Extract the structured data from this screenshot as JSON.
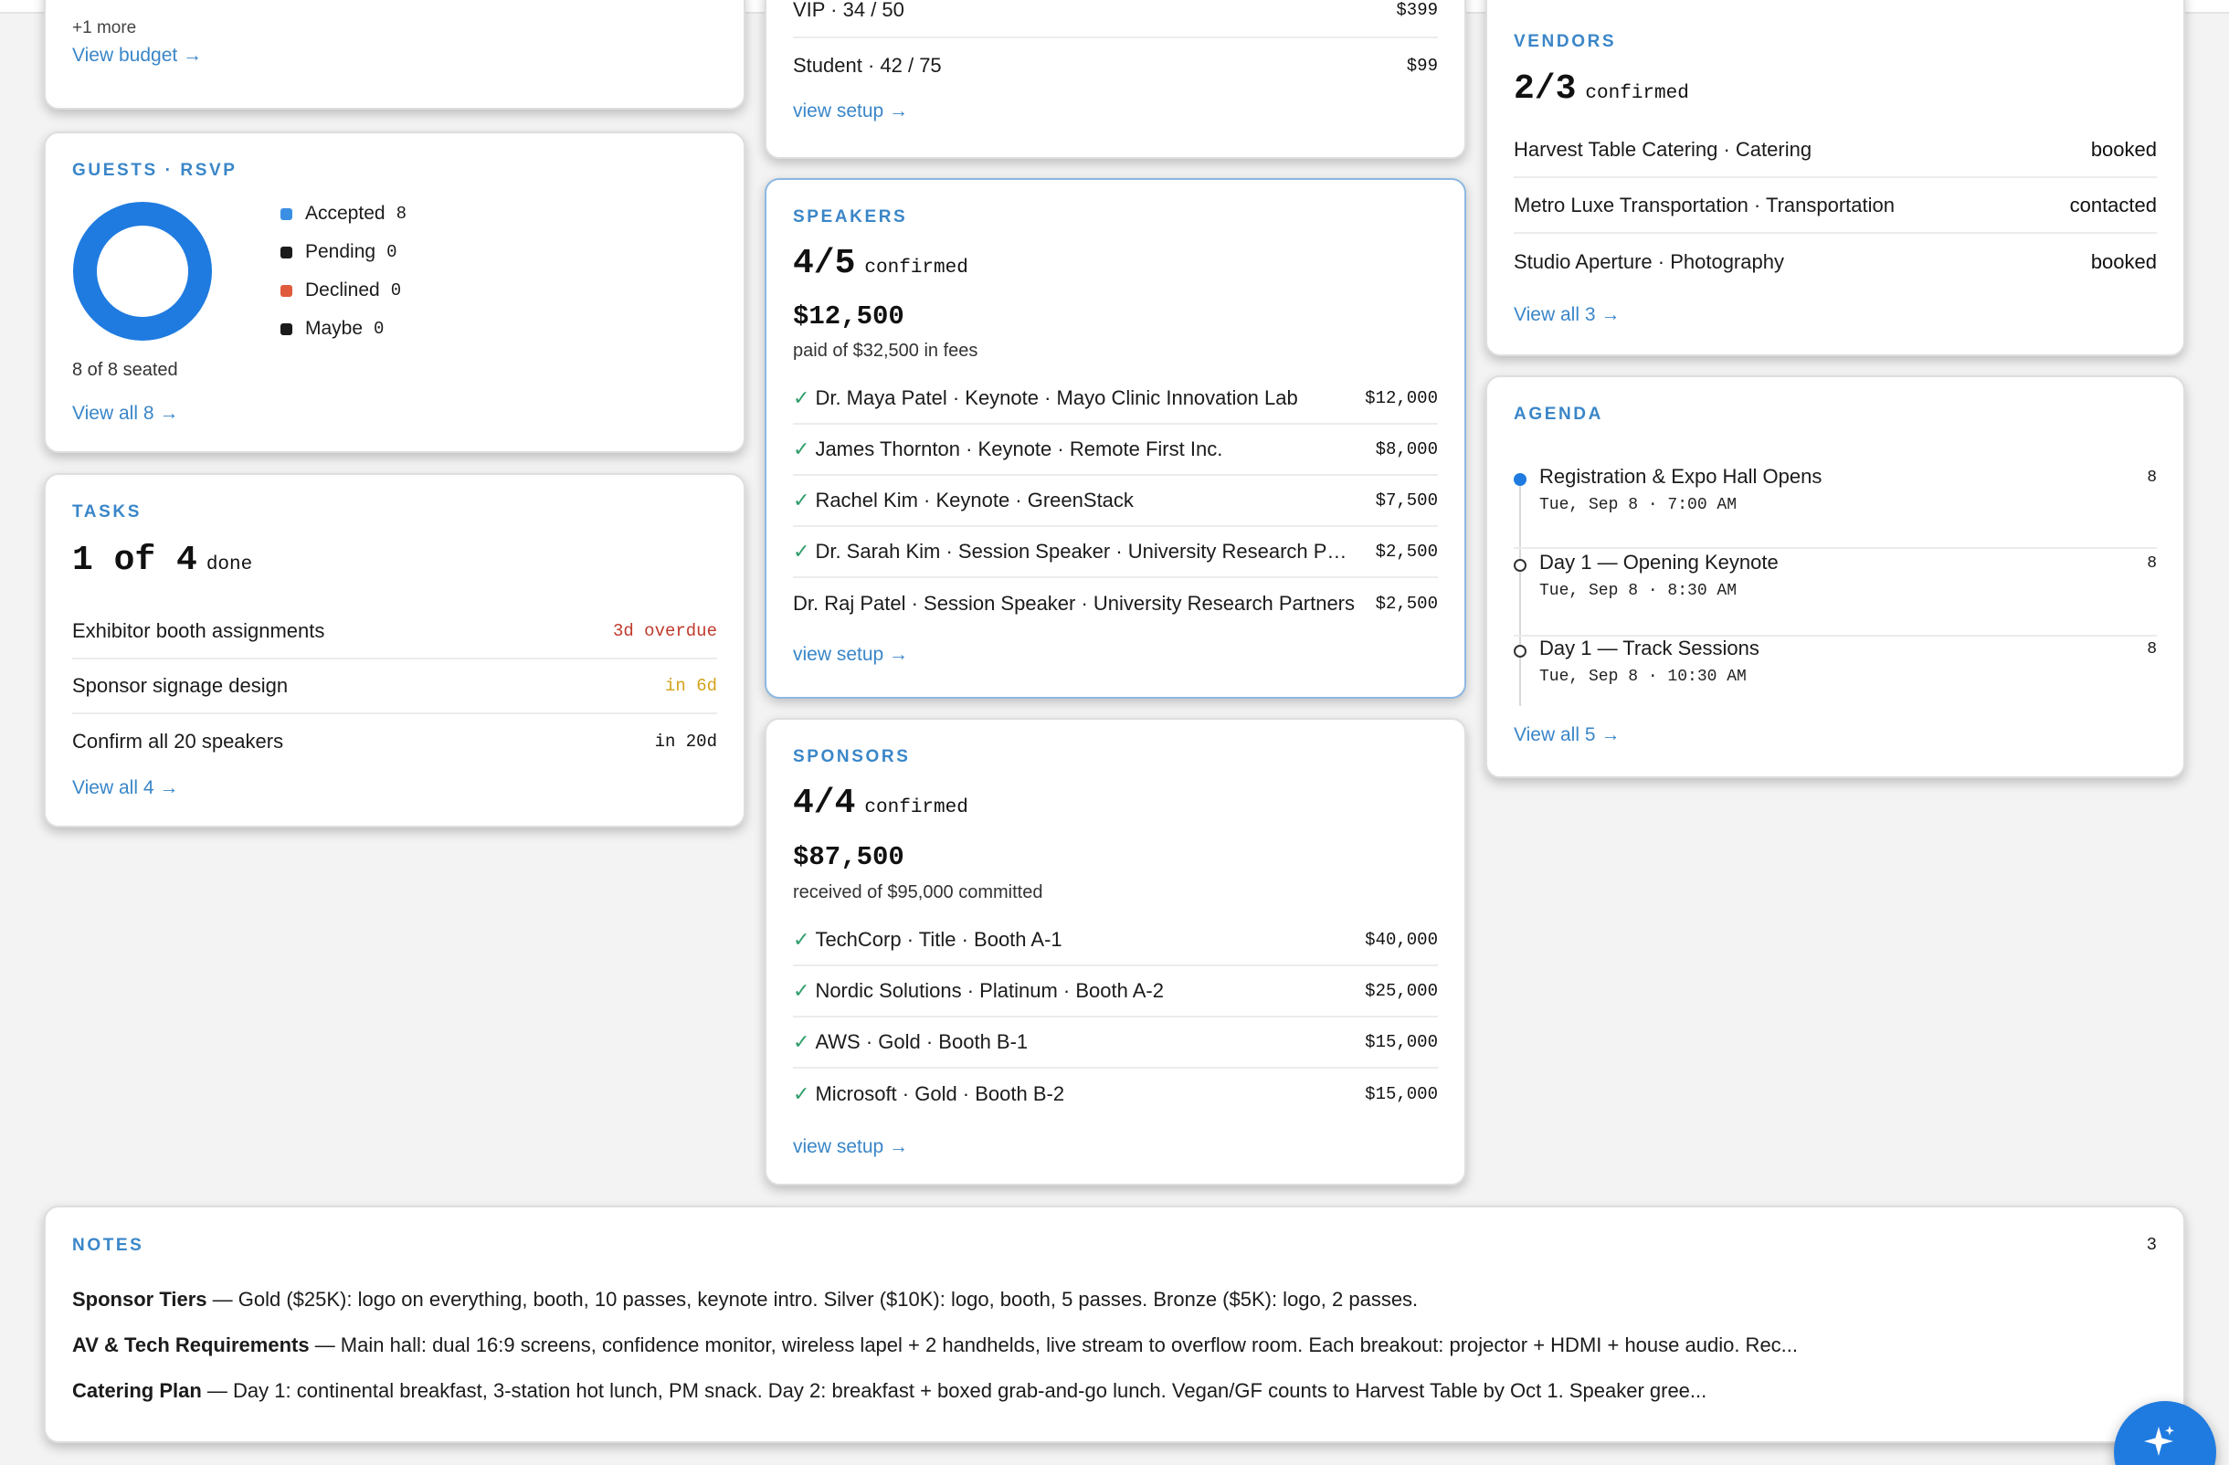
{
  "budget": {
    "more": "+1 more",
    "link": "View budget →"
  },
  "guests": {
    "title": "GUESTS · RSVP",
    "legend": [
      {
        "label": "Accepted",
        "count": "8",
        "color": "#3b8fe3"
      },
      {
        "label": "Pending",
        "count": "0",
        "color": "#1b1b1b"
      },
      {
        "label": "Declined",
        "count": "0",
        "color": "#e05a3c"
      },
      {
        "label": "Maybe",
        "count": "0",
        "color": "#1b1b1b"
      }
    ],
    "donut_color": "#1f7be0",
    "seated": "8 of 8 seated",
    "link": "View all 8 →"
  },
  "tasks": {
    "title": "TASKS",
    "big": "1 of 4",
    "suffix": "done",
    "items": [
      {
        "label": "Exhibitor booth assignments",
        "due": "3d overdue"
      },
      {
        "label": "Sponsor signage design",
        "due": "in 6d"
      },
      {
        "label": "Confirm all 20 speakers",
        "due": "in 20d"
      }
    ],
    "link": "View all 4 →"
  },
  "tickets": {
    "partial_label": "VIP · 34 / 50",
    "partial_value": "$399",
    "row_label": "Student · 42 / 75",
    "row_value": "$99",
    "link": "view setup →"
  },
  "speakers": {
    "title": "SPEAKERS",
    "big": "4/5",
    "suffix": "confirmed",
    "amount": "$12,500",
    "amount_sub": "paid of $32,500 in fees",
    "items": [
      {
        "check": "✓",
        "label": "Dr. Maya Patel · Keynote · Mayo Clinic Innovation Lab",
        "fee": "$12,000"
      },
      {
        "check": "✓",
        "label": "James Thornton · Keynote · Remote First Inc.",
        "fee": "$8,000"
      },
      {
        "check": "✓",
        "label": "Rachel Kim · Keynote · GreenStack",
        "fee": "$7,500"
      },
      {
        "check": "✓",
        "label": "Dr. Sarah Kim · Session Speaker · University Research Par...",
        "fee": "$2,500"
      },
      {
        "check": "",
        "label": "Dr. Raj Patel · Session Speaker · University Research Partners",
        "fee": "$2,500"
      }
    ],
    "link": "view setup →"
  },
  "sponsors": {
    "title": "SPONSORS",
    "big": "4/4",
    "suffix": "confirmed",
    "amount": "$87,500",
    "amount_sub": "received of $95,000 committed",
    "items": [
      {
        "check": "✓",
        "label": "TechCorp · Title · Booth A-1",
        "amount": "$40,000"
      },
      {
        "check": "✓",
        "label": "Nordic Solutions · Platinum · Booth A-2",
        "amount": "$25,000"
      },
      {
        "check": "✓",
        "label": "AWS · Gold · Booth B-1",
        "amount": "$15,000"
      },
      {
        "check": "✓",
        "label": "Microsoft · Gold · Booth B-2",
        "amount": "$15,000"
      }
    ],
    "link": "view setup →"
  },
  "vendors": {
    "title": "VENDORS",
    "big": "2/3",
    "suffix": "confirmed",
    "items": [
      {
        "label": "Harvest Table Catering · Catering",
        "status": "booked"
      },
      {
        "label": "Metro Luxe Transportation · Transportation",
        "status": "contacted"
      },
      {
        "label": "Studio Aperture · Photography",
        "status": "booked"
      }
    ],
    "link": "View all 3 →"
  },
  "agenda": {
    "title": "AGENDA",
    "items": [
      {
        "name": "Registration & Expo Hall Opens",
        "when": "Tue, Sep 8 · 7:00 AM",
        "count": "8"
      },
      {
        "name": "Day 1 — Opening Keynote",
        "when": "Tue, Sep 8 · 8:30 AM",
        "count": "8"
      },
      {
        "name": "Day 1 — Track Sessions",
        "when": "Tue, Sep 8 · 10:30 AM",
        "count": "8"
      }
    ],
    "link": "View all 5 →"
  },
  "notes": {
    "title": "NOTES",
    "count": "3",
    "items": [
      {
        "title": "Sponsor Tiers",
        "body": " — Gold ($25K): logo on everything, booth, 10 passes, keynote intro. Silver ($10K): logo, booth, 5 passes. Bronze ($5K): logo, 2 passes."
      },
      {
        "title": "AV & Tech Requirements",
        "body": " — Main hall: dual 16:9 screens, confidence monitor, wireless lapel + 2 handhelds, live stream to overflow room. Each breakout: projector + HDMI + house audio. Rec..."
      },
      {
        "title": "Catering Plan",
        "body": " — Day 1: continental breakfast, 3-station hot lunch, PM snack. Day 2: breakfast + boxed grab-and-go lunch. Vegan/GF counts to Harvest Table by Oct 1. Speaker gree..."
      }
    ]
  },
  "fab": {
    "icon": "sparkle-icon"
  }
}
